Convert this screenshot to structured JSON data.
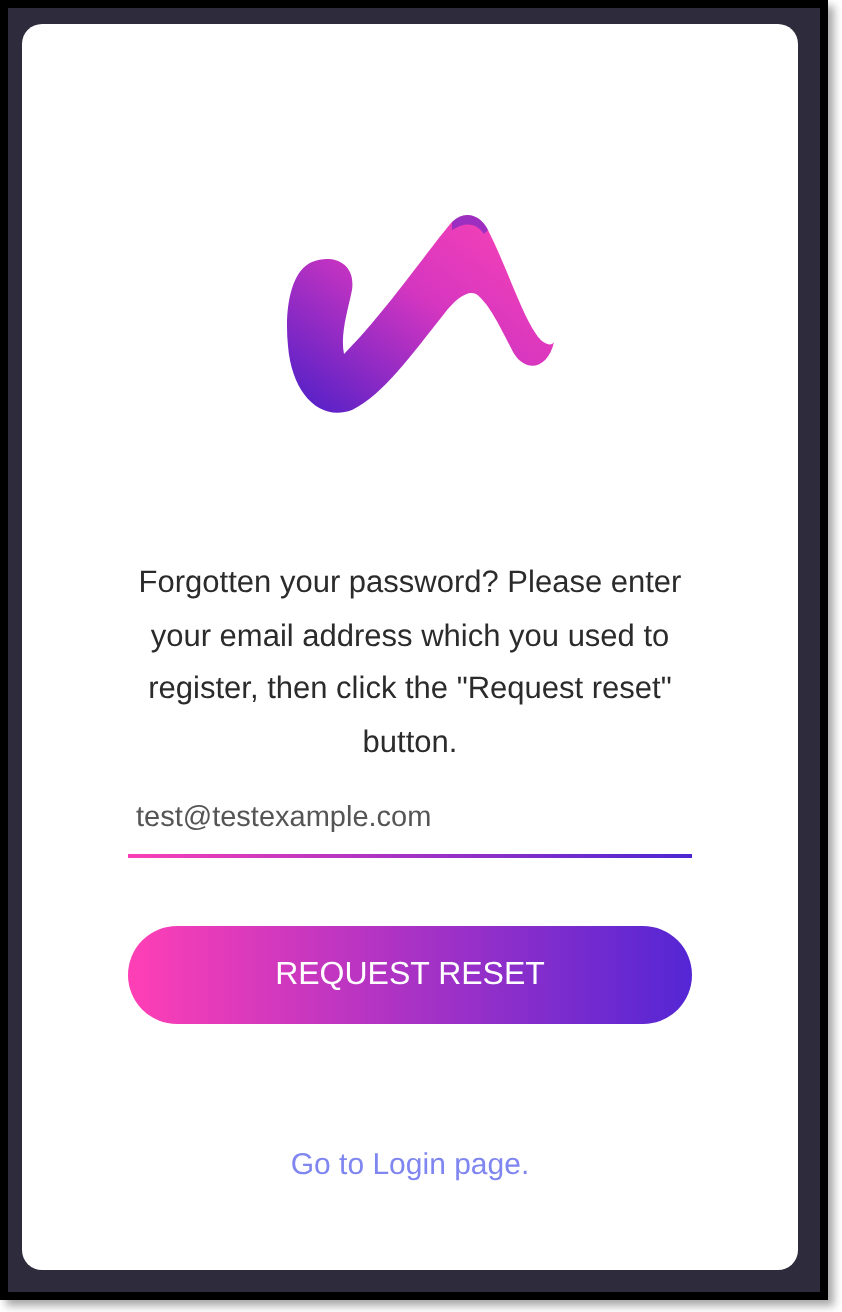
{
  "message": "Forgotten your password? Please enter your email address which you used to register, then click the \"Request reset\" button.",
  "email": {
    "value": "test@testexample.com"
  },
  "submit": {
    "label": "REQUEST RESET"
  },
  "login_link": {
    "label": "Go to Login page."
  }
}
